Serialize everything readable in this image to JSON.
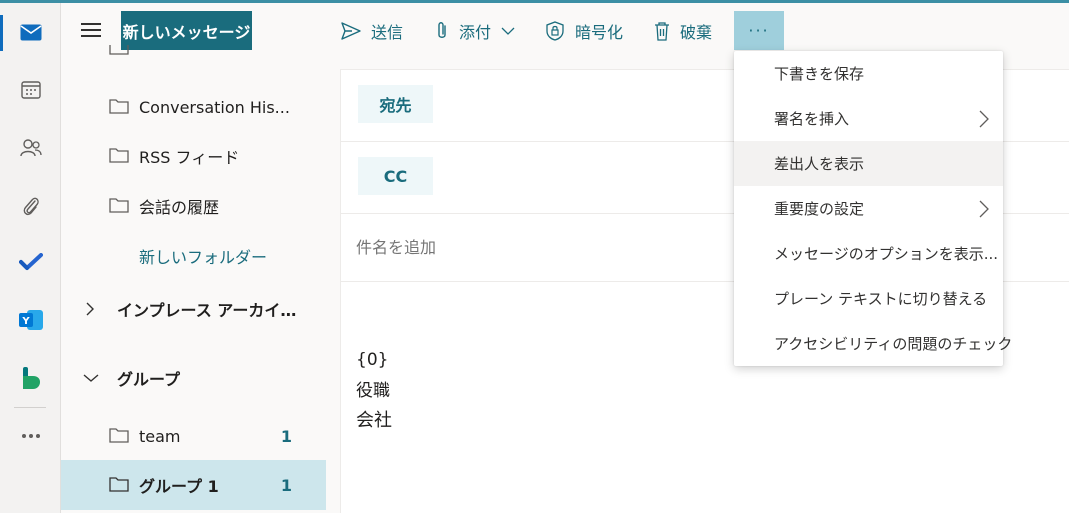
{
  "toolbar": {
    "new_message": "新しいメッセージ",
    "send": "送信",
    "attach": "添付",
    "encrypt": "暗号化",
    "discard": "破棄",
    "more": "···"
  },
  "folders": {
    "items": [
      {
        "label": "Conversation His...",
        "count": ""
      },
      {
        "label": "RSS フィード",
        "count": ""
      },
      {
        "label": "会話の履歴",
        "count": ""
      },
      {
        "label": "新しいフォルダー",
        "count": ""
      },
      {
        "label": "インプレース アーカイブ -...",
        "count": ""
      },
      {
        "label": "グループ",
        "count": ""
      },
      {
        "label": "team",
        "count": "1"
      },
      {
        "label": "グループ 1",
        "count": "1"
      }
    ]
  },
  "compose": {
    "to_label": "宛先",
    "cc_label": "CC",
    "subject_placeholder": "件名を追加",
    "body_lines": [
      "{0}",
      "役職",
      "会社"
    ]
  },
  "menu": {
    "items": [
      {
        "label": "下書きを保存",
        "has_submenu": false
      },
      {
        "label": "署名を挿入",
        "has_submenu": true
      },
      {
        "label": "差出人を表示",
        "has_submenu": false
      },
      {
        "label": "重要度の設定",
        "has_submenu": true
      },
      {
        "label": "メッセージのオプションを表示...",
        "has_submenu": false
      },
      {
        "label": "プレーン テキストに切り替える",
        "has_submenu": false
      },
      {
        "label": "アクセシビリティの問題のチェック",
        "has_submenu": false
      }
    ]
  },
  "colors": {
    "accent": "#1a6c7d",
    "selected_folder": "#cde6ec",
    "more_button": "#9fcfdc",
    "top_line": "#3c8fa5"
  },
  "rail_icons": [
    "mail-icon",
    "calendar-icon",
    "people-icon",
    "attachment-icon",
    "todo-icon",
    "yammer-icon",
    "bookings-icon",
    "more-apps-icon"
  ]
}
